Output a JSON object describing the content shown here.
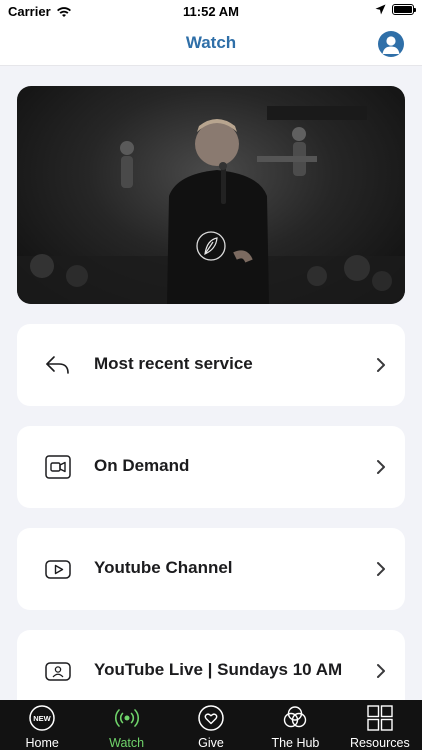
{
  "status_bar": {
    "carrier": "Carrier",
    "time": "11:52 AM"
  },
  "nav": {
    "title": "Watch"
  },
  "cards": [
    {
      "label": "Most recent service",
      "icon": "reply-arrow-icon"
    },
    {
      "label": "On Demand",
      "icon": "video-camera-icon"
    },
    {
      "label": "Youtube Channel",
      "icon": "play-button-icon"
    },
    {
      "label": "YouTube Live | Sundays 10 AM",
      "icon": "contact-card-icon"
    }
  ],
  "tabs": [
    {
      "label": "Home",
      "icon": "new-badge-icon",
      "active": false
    },
    {
      "label": "Watch",
      "icon": "broadcast-icon",
      "active": true
    },
    {
      "label": "Give",
      "icon": "heart-icon",
      "active": false
    },
    {
      "label": "The Hub",
      "icon": "circles-icon",
      "active": false
    },
    {
      "label": "Resources",
      "icon": "grid-icon",
      "active": false
    }
  ],
  "hero": {
    "badge_icon": "leaf-logo-icon"
  },
  "colors": {
    "accent": "#2f6fa8",
    "active_tab": "#6fd36a",
    "tabbar": "#121212",
    "background": "#f2f3f8"
  }
}
